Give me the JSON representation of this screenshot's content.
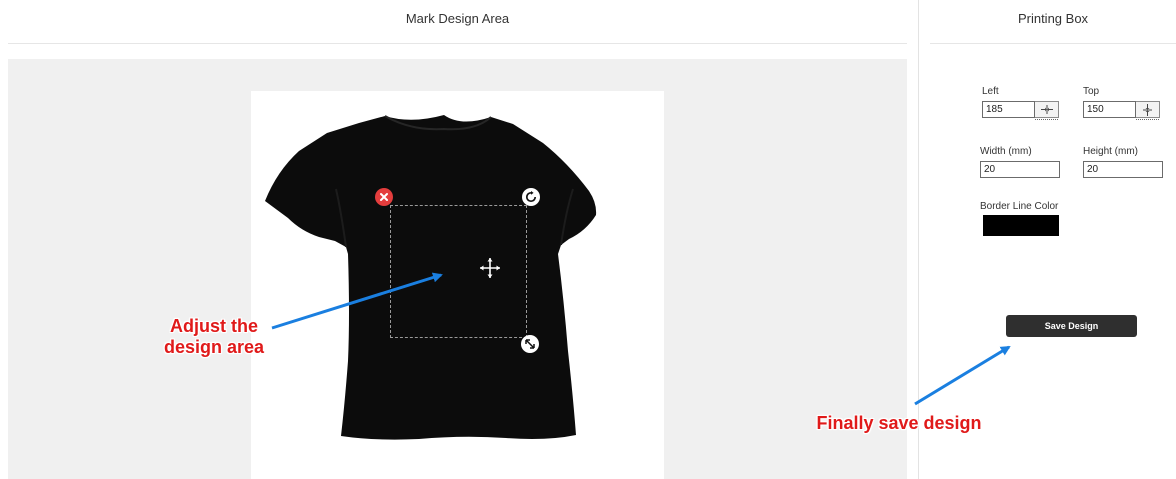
{
  "panels": {
    "left_title": "Mark Design Area",
    "right_title": "Printing Box"
  },
  "fields": {
    "left": {
      "label": "Left",
      "value": "185"
    },
    "top": {
      "label": "Top",
      "value": "150"
    },
    "width": {
      "label": "Width (mm)",
      "value": "20"
    },
    "height": {
      "label": "Height (mm)",
      "value": "20"
    },
    "border_color": {
      "label": "Border Line Color",
      "value": "#000000"
    }
  },
  "buttons": {
    "save": "Save Design"
  },
  "annotations": {
    "adjust_line1": "Adjust the",
    "adjust_line2": "design area",
    "save_hint": "Finally save design"
  },
  "colors": {
    "accent_arrow": "#1a7fe0",
    "annotation_text": "#e01a1a",
    "delete_handle": "#e43d3d",
    "save_button": "#2f2f2f"
  },
  "icons": {
    "delete": "close-icon",
    "rotate": "rotate-icon",
    "resize": "resize-icon",
    "move": "move-icon",
    "center_horizontal": "center-horizontal-icon",
    "center_vertical": "center-vertical-icon"
  }
}
